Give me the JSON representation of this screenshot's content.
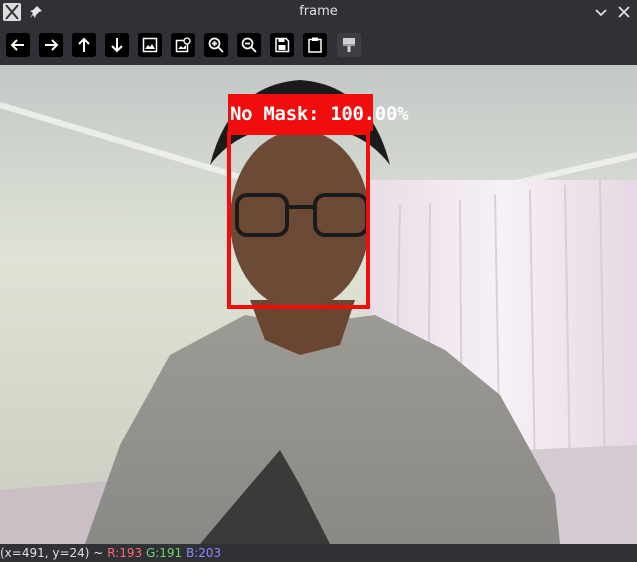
{
  "window": {
    "title": "frame"
  },
  "toolbar": {
    "tools": [
      {
        "name": "pan-left",
        "icon": "arrow-left-icon"
      },
      {
        "name": "pan-right",
        "icon": "arrow-right-icon"
      },
      {
        "name": "pan-up",
        "icon": "arrow-up-icon"
      },
      {
        "name": "pan-down",
        "icon": "arrow-down-icon"
      },
      {
        "name": "zoom-to-fit",
        "icon": "image-icon"
      },
      {
        "name": "zoom-actual",
        "icon": "image-zoom-icon"
      },
      {
        "name": "zoom-in",
        "icon": "zoom-in-icon"
      },
      {
        "name": "zoom-out",
        "icon": "zoom-out-icon"
      },
      {
        "name": "save-image",
        "icon": "save-icon"
      },
      {
        "name": "copy-clipboard",
        "icon": "clipboard-icon"
      },
      {
        "name": "properties",
        "icon": "paint-icon"
      }
    ]
  },
  "detection": {
    "label": "No Mask: 100.00%",
    "color": "#f20d0d"
  },
  "status": {
    "coords": "(x=491, y=24) ~",
    "r": "R:193",
    "g": "G:191",
    "b": "B:203",
    "colors": {
      "r": "#ff6b6b",
      "g": "#6bd96b",
      "b": "#8a8aff"
    }
  }
}
